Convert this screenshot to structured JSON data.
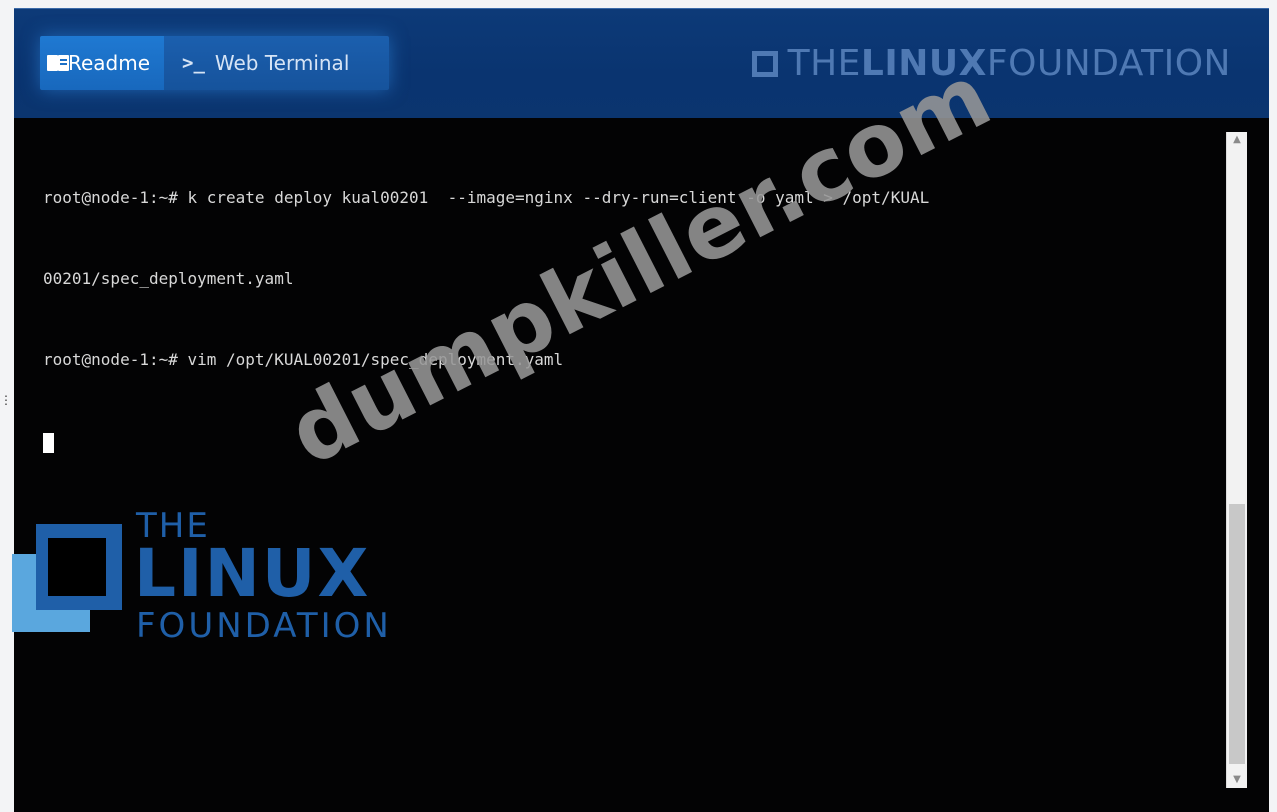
{
  "header": {
    "tabs": [
      {
        "label": "Readme",
        "icon": "book-icon",
        "active": true
      },
      {
        "label": "Web Terminal",
        "icon": "terminal-prompt-icon",
        "active": false
      }
    ],
    "brand_thin_1": "THE",
    "brand_bold": "LINUX",
    "brand_thin_2": "FOUNDATION"
  },
  "terminal": {
    "lines": [
      "root@node-1:~# k create deploy kual00201  --image=nginx --dry-run=client -o yaml > /opt/KUAL",
      "00201/spec_deployment.yaml",
      "root@node-1:~# vim /opt/KUAL00201/spec_deployment.yaml"
    ]
  },
  "logo": {
    "the": "THE",
    "linux": "LINUX",
    "foundation": "FOUNDATION"
  },
  "watermark": {
    "text": "dumpkiller.com"
  },
  "colors": {
    "header_bg": "#0a3470",
    "terminal_bg": "#030304",
    "terminal_text": "#d8d8d8",
    "logo_blue": "#1f5fa8",
    "tab_blue": "#1f79d2"
  }
}
